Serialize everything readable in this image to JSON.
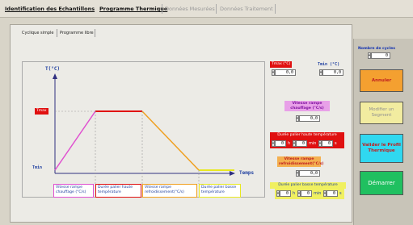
{
  "tabs": {
    "t1": "Identification des Echantillons",
    "t2": "Programme Thermique",
    "t3": "Données Mesurées",
    "t4": "Données Traitement"
  },
  "subtabs": {
    "s1": "Cyclique simple",
    "s2": "Programme libre"
  },
  "chart": {
    "ylabel": "T(°C)",
    "xlabel": "Temps",
    "tmax_label": "Tmax",
    "tmin_label": "Tmin",
    "ramp_up": "Vitesse rampe chauffage (°C/s)",
    "high_dwell": "Durée palier haute température",
    "ramp_down": "Vitesse rampe refroidissement(°C/s)",
    "low_dwell": "Durée palier basse température"
  },
  "params": {
    "tmax_label": "Tmax (°C)",
    "tmax_value": "0,0",
    "tmin_label": "Tmin (°C)",
    "tmin_value": "0,0",
    "ramp_up_label": "Vitesse rampe chauffage (°C/s)",
    "ramp_up_value": "0,0",
    "high_dwell_label": "Durée palier haute température",
    "high_h": "0",
    "high_m": "0",
    "high_s": "0",
    "unit_h": "h",
    "unit_m": "min",
    "unit_s": "s",
    "ramp_down_label": "Vitesse rampe refroidissement(°C/s)",
    "ramp_down_value": "0,0",
    "low_dwell_label": "Durée palier basse température",
    "low_h": "0",
    "low_m": "0",
    "low_s": "0"
  },
  "right_panel": {
    "cycles_label": "Nombre de cycles",
    "cycles_value": "0",
    "annuler": "Annuler",
    "modifier": "Modifier un Segment",
    "valider": "Valider le Profil Thermique",
    "demarrer": "Démarrer"
  },
  "colors": {
    "red": "#e01010",
    "pink": "#e050d0",
    "orange": "#f0a020",
    "yellow": "#e8e820",
    "blue": "#2040c0"
  }
}
